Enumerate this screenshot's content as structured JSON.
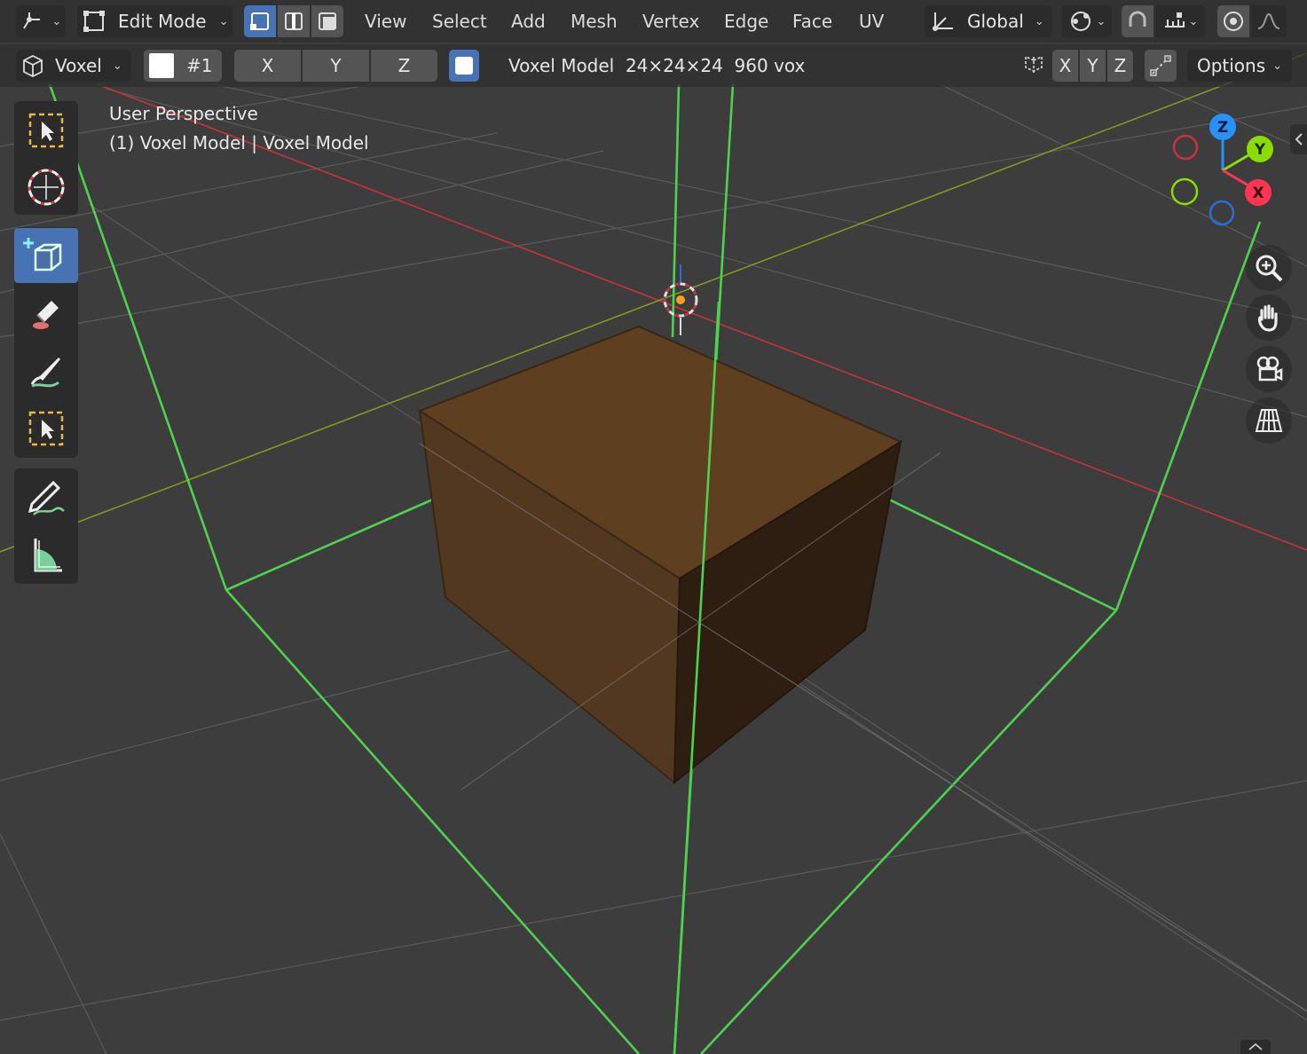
{
  "header": {
    "editor_type_icon": "view3d-icon",
    "mode_label": "Edit Mode",
    "select_modes": [
      "vertex-select-icon",
      "edge-select-icon",
      "face-select-icon"
    ],
    "menus": [
      "View",
      "Select",
      "Add",
      "Mesh",
      "Vertex",
      "Edge",
      "Face",
      "UV"
    ],
    "transform_orientation": "Global"
  },
  "tool_header": {
    "tool_name": "Voxel",
    "color_index": "#1",
    "axes": [
      "X",
      "Y",
      "Z"
    ],
    "model_info": "Voxel Model  24×24×24  960 vox",
    "mirror_axes": [
      "X",
      "Y",
      "Z"
    ],
    "options_label": "Options"
  },
  "viewport": {
    "view_name": "User Perspective",
    "object_info": "(1) Voxel Model | Voxel Model",
    "gizmo": {
      "x": "X",
      "y": "Y",
      "z": "Z"
    },
    "colors": {
      "x_axis": "#ff3352",
      "y_axis": "#8bdc00",
      "z_axis": "#2890ff",
      "bounds": "#4ed24e",
      "voxel_top": "#5e3f20",
      "voxel_front": "#533820",
      "voxel_right": "#2e1e12"
    }
  },
  "toolbar": {
    "tools": [
      "select-box-icon",
      "cursor-icon",
      "add-voxel-icon",
      "erase-icon",
      "paint-icon",
      "select-region-icon",
      "annotate-icon",
      "measure-icon"
    ]
  },
  "navigation": [
    "zoom-icon",
    "pan-hand-icon",
    "camera-icon",
    "grid-view-icon"
  ]
}
